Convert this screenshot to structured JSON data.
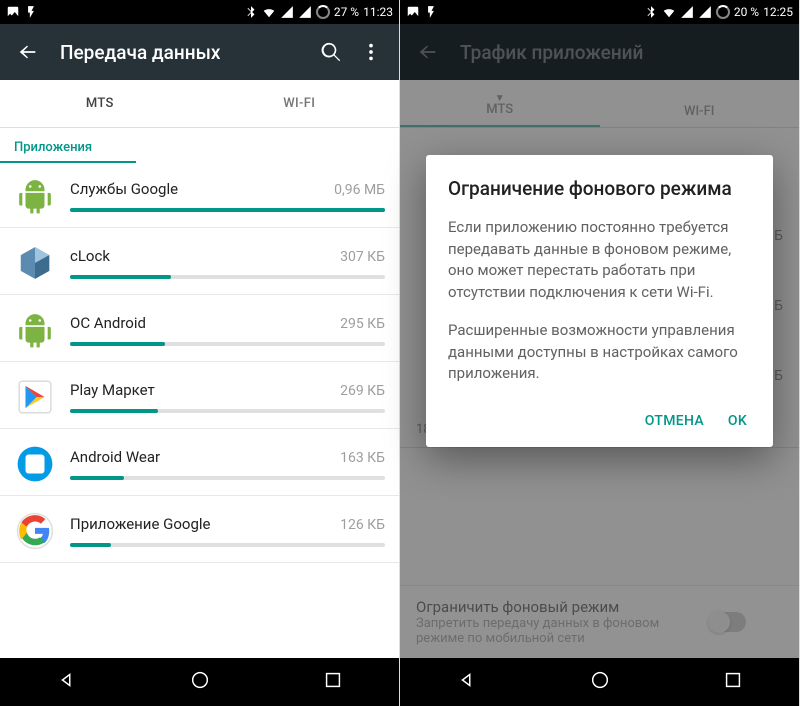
{
  "left": {
    "status": {
      "battery": "27 %",
      "time": "11:23"
    },
    "appbar": {
      "title": "Передача данных"
    },
    "tabs": [
      "MTS",
      "WI-FI"
    ],
    "active_tab": 0,
    "section": "Приложения",
    "apps": [
      {
        "name": "Службы Google",
        "size": "0,96 МБ",
        "pct": 100,
        "icon": "android"
      },
      {
        "name": "cLock",
        "size": "307 КБ",
        "pct": 32,
        "icon": "cube"
      },
      {
        "name": "ОС Android",
        "size": "295 КБ",
        "pct": 30,
        "icon": "android"
      },
      {
        "name": "Play Маркет",
        "size": "269 КБ",
        "pct": 28,
        "icon": "play"
      },
      {
        "name": "Android Wear",
        "size": "163 КБ",
        "pct": 17,
        "icon": "wear"
      },
      {
        "name": "Приложение Google",
        "size": "126 КБ",
        "pct": 13,
        "icon": "google"
      }
    ]
  },
  "right": {
    "status": {
      "battery": "20 %",
      "time": "12:25"
    },
    "appbar": {
      "title": "Трафик приложений"
    },
    "tabs": [
      "MTS",
      "WI-FI"
    ],
    "active_tab": 0,
    "bg_x_left": "18",
    "toggle": {
      "title": "Ограничить фоновый режим",
      "subtitle": "Запретить передачу данных в фоновом режиме по мобильной сети"
    },
    "dialog": {
      "title": "Ограничение фонового режима",
      "p1": "Если приложению постоянно требуется передавать данные в фоновом режиме, оно может перестать работать при отсутствии подключения к сети Wi-Fi.",
      "p2": "Расширенные возможности управления данными доступны в настройках самого приложения.",
      "cancel": "ОТМЕНА",
      "ok": "OK"
    }
  }
}
